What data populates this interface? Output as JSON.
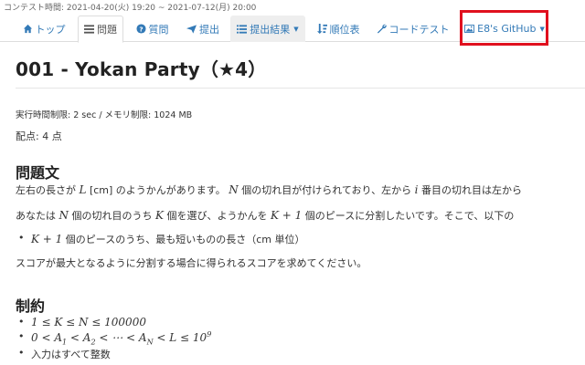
{
  "contest_time": "コンテスト時間: 2021-04-20(火) 19:20 ~ 2021-07-12(月) 20:00",
  "nav": {
    "top": "トップ",
    "problem": "問題",
    "question": "質問",
    "submit": "提出",
    "results": "提出結果",
    "standings": "順位表",
    "codetest": "コードテスト",
    "github": "E8's GitHub"
  },
  "problem": {
    "title": "001 - Yokan Party（★4）",
    "limits": "実行時間制限: 2 sec / メモリ制限: 1024 MB",
    "score": "配点: 4 点"
  },
  "statement": {
    "heading": "問題文",
    "p1_a": "左右の長さが",
    "var_L": "L",
    "p1_b": " [cm] のようかんがあります。",
    "var_N": "N",
    "p1_c": " 個の切れ目が付けられており、左から",
    "var_i": "i",
    "p1_d": " 番目の切れ目は左から",
    "p2_a": "あなたは",
    "p2_b": " 個の切れ目のうち",
    "var_K": "K",
    "p2_c": " 個を選び、ようかんを",
    "expr_K1": "K + 1",
    "p2_d": " 個のピースに分割したいです。そこで、以下の",
    "bullet_b": " 個のピースのうち、最も短いものの長さ（cm 単位）",
    "p3": "スコアが最大となるように分割する場合に得られるスコアを求めてください。"
  },
  "constraints": {
    "heading": "制約",
    "c1": "1 ≤ K ≤ N ≤ 100000",
    "c2_text": "入力はすべて整数"
  }
}
